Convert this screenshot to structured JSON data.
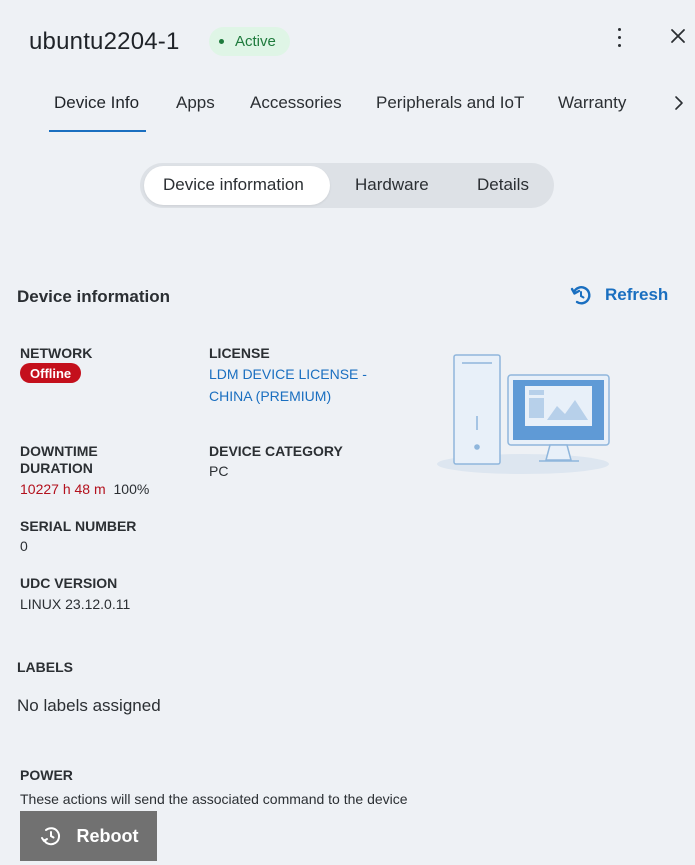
{
  "header": {
    "device_name": "ubuntu2204-1",
    "status": "Active"
  },
  "tabs": [
    {
      "label": "Device Info",
      "active": true
    },
    {
      "label": "Apps"
    },
    {
      "label": "Accessories"
    },
    {
      "label": "Peripherals and IoT"
    },
    {
      "label": "Warranty"
    }
  ],
  "segments": [
    {
      "label": "Device information",
      "active": true
    },
    {
      "label": "Hardware"
    },
    {
      "label": "Details"
    }
  ],
  "section": {
    "title": "Device information",
    "refresh_label": "Refresh"
  },
  "fields": {
    "network_label": "NETWORK",
    "network_value": "Offline",
    "license_label": "LICENSE",
    "license_line1": "LDM DEVICE LICENSE -",
    "license_line2": "CHINA (PREMIUM)",
    "downtime_label_1": "DOWNTIME",
    "downtime_label_2": "DURATION",
    "downtime_value": "10227 h 48 m",
    "downtime_pct": "100%",
    "category_label": "DEVICE CATEGORY",
    "category_value": "PC",
    "serial_label": "SERIAL NUMBER",
    "serial_value": "0",
    "udc_label": "UDC VERSION",
    "udc_value": "LINUX 23.12.0.11"
  },
  "labels": {
    "title": "LABELS",
    "empty": "No labels assigned"
  },
  "power": {
    "title": "POWER",
    "description": "These actions will send the associated command to the device",
    "reboot_label": "Reboot"
  },
  "colors": {
    "accent": "#1a6fc0",
    "active_badge_bg": "#dff5e6",
    "offline": "#c4101c",
    "button_gray": "#717171"
  },
  "icons": [
    "kebab-menu-icon",
    "close-icon",
    "chevron-right-icon",
    "refresh-icon",
    "computer-illustration",
    "reboot-icon"
  ]
}
